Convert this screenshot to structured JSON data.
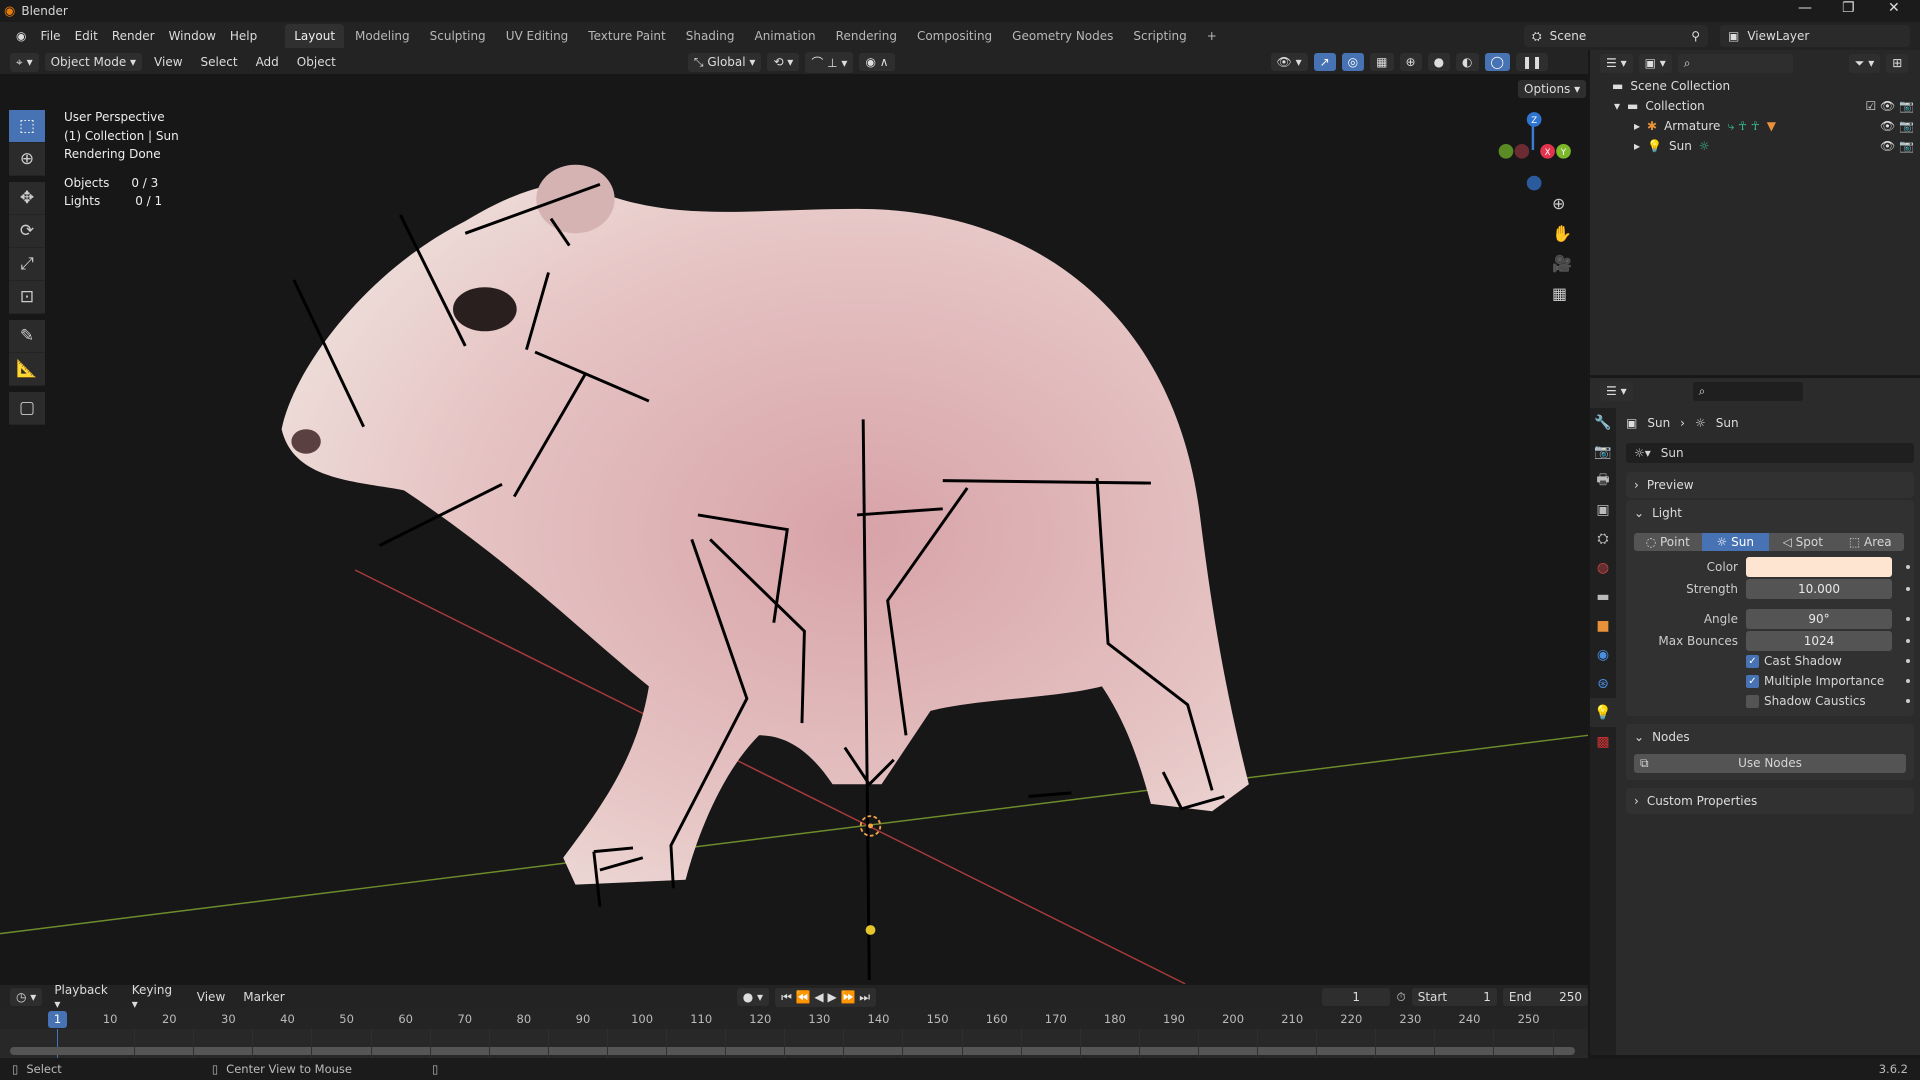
{
  "window": {
    "title": "Blender",
    "minimize": "—",
    "maximize": "❐",
    "close": "✕"
  },
  "menu": [
    "File",
    "Edit",
    "Render",
    "Window",
    "Help"
  ],
  "workspaces": [
    "Layout",
    "Modeling",
    "Sculpting",
    "UV Editing",
    "Texture Paint",
    "Shading",
    "Animation",
    "Rendering",
    "Compositing",
    "Geometry Nodes",
    "Scripting",
    "+"
  ],
  "scene": {
    "name": "Scene",
    "view_layer": "ViewLayer"
  },
  "viewport_header": {
    "mode": "Object Mode",
    "menus": [
      "View",
      "Select",
      "Add",
      "Object"
    ],
    "orientation": "Global",
    "options": "Options"
  },
  "overlay": {
    "line1": "User Perspective",
    "line2": "(1) Collection | Sun",
    "line3": "Rendering Done",
    "objects_label": "Objects",
    "objects_value": "0 / 3",
    "lights_label": "Lights",
    "lights_value": "0 / 1"
  },
  "gizmo": {
    "z": "Z",
    "x": "X",
    "y": "Y"
  },
  "outliner": {
    "root": "Scene Collection",
    "collection": "Collection",
    "items": [
      {
        "name": "Armature"
      },
      {
        "name": "Sun"
      }
    ]
  },
  "properties": {
    "breadcrumb_object": "Sun",
    "breadcrumb_data": "Sun",
    "datablock": "Sun",
    "preview": "Preview",
    "light": "Light",
    "types": [
      "Point",
      "Sun",
      "Spot",
      "Area"
    ],
    "active_type": "Sun",
    "color_label": "Color",
    "color_value": "#fde5d2",
    "strength_label": "Strength",
    "strength": "10.000",
    "angle_label": "Angle",
    "angle": "90°",
    "bounces_label": "Max Bounces",
    "bounces": "1024",
    "cast_shadow": "Cast Shadow",
    "multiple_importance": "Multiple Importance",
    "shadow_caustics": "Shadow Caustics",
    "cast_shadow_on": true,
    "multiple_importance_on": true,
    "shadow_caustics_on": false,
    "nodes": "Nodes",
    "use_nodes": "Use Nodes",
    "custom_properties": "Custom Properties"
  },
  "timeline": {
    "menus": [
      "Playback",
      "Keying",
      "View",
      "Marker"
    ],
    "current_frame": "1",
    "start_label": "Start",
    "start": "1",
    "end_label": "End",
    "end": "250",
    "ticks": [
      "10",
      "20",
      "30",
      "40",
      "50",
      "60",
      "70",
      "80",
      "90",
      "100",
      "110",
      "120",
      "130",
      "140",
      "150",
      "160",
      "170",
      "180",
      "190",
      "200",
      "210",
      "220",
      "230",
      "240",
      "250"
    ],
    "playhead": "1"
  },
  "status": {
    "select": "Select",
    "center": "Center View to Mouse",
    "version": "3.6.2"
  }
}
